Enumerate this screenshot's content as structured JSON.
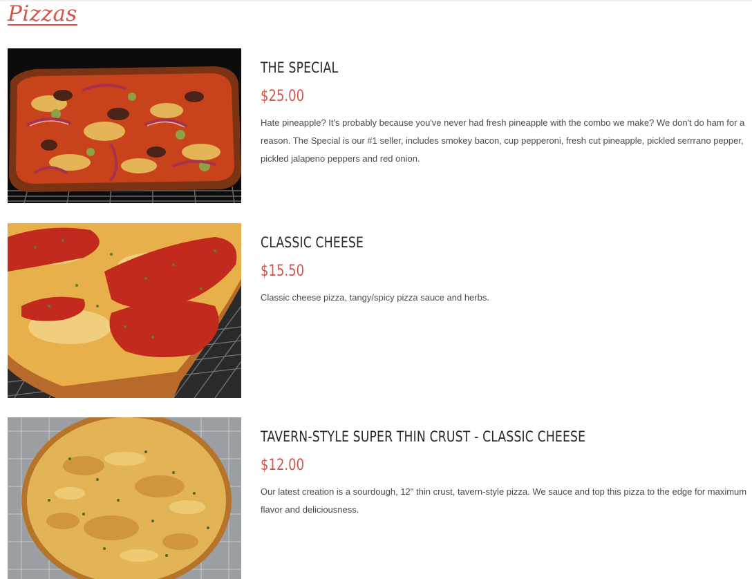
{
  "section": {
    "title": "Pizzas"
  },
  "items": [
    {
      "name": "THE SPECIAL",
      "price": "$25.00",
      "description": "Hate pineapple? It's probably because you've never had fresh pineapple with the combo we make? We don't do ham for a reason. The Special is our #1 seller, includes smokey bacon, cup pepperoni, fresh cut pineapple, pickled serrrano pepper, pickled jalapeno peppers and red onion."
    },
    {
      "name": "CLASSIC CHEESE",
      "price": "$15.50",
      "description": "Classic cheese pizza, tangy/spicy pizza sauce and herbs."
    },
    {
      "name": "TAVERN-STYLE SUPER THIN CRUST - CLASSIC CHEESE",
      "price": "$12.00",
      "description": "Our latest creation is a sourdough, 12\" thin crust, tavern-style pizza. We sauce and top this pizza to the edge for maximum flavor and deliciousness."
    }
  ],
  "colors": {
    "accent": "#d2564c",
    "heading": "#2a2a2a",
    "body_text": "#4a4a4a"
  }
}
